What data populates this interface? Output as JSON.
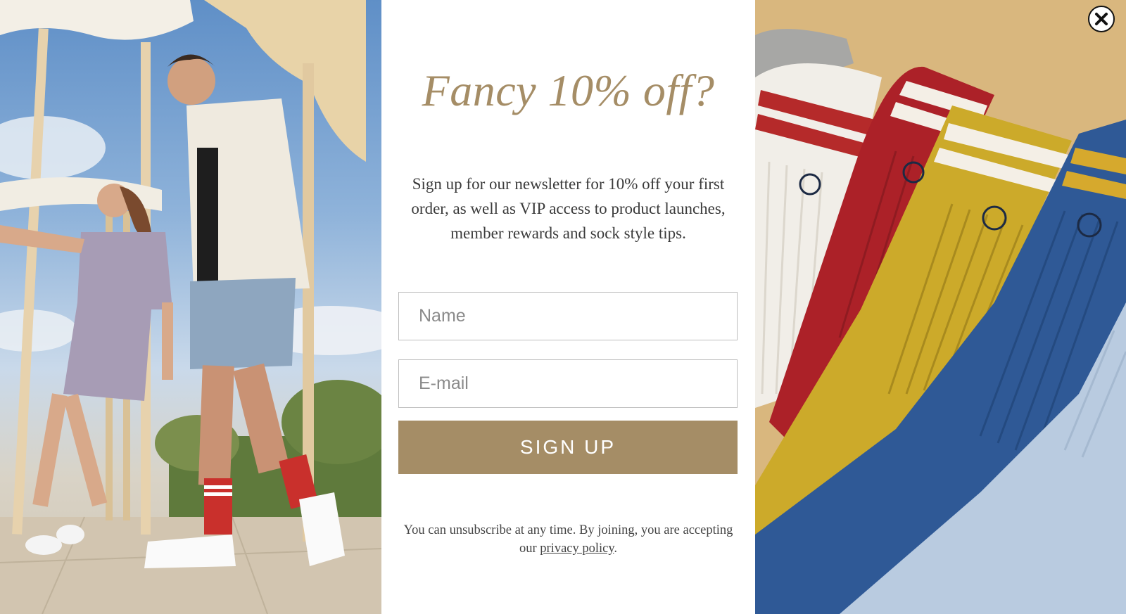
{
  "popup": {
    "headline": "Fancy 10% off?",
    "body": "Sign up for our newsletter for 10% off your first order, as well as VIP access to product launches, member rewards and sock style tips.",
    "name_placeholder": "Name",
    "email_placeholder": "E-mail",
    "signup_label": "SIGN UP",
    "fine_print_prefix": "You can unsubscribe at any time. By joining, you are accepting our ",
    "privacy_link": "privacy policy",
    "fine_print_suffix": "."
  },
  "icons": {
    "close": "close-icon"
  },
  "colors": {
    "accent": "#a58d66",
    "body_text": "#3b3b3b",
    "field_border": "#bdbdbd"
  }
}
